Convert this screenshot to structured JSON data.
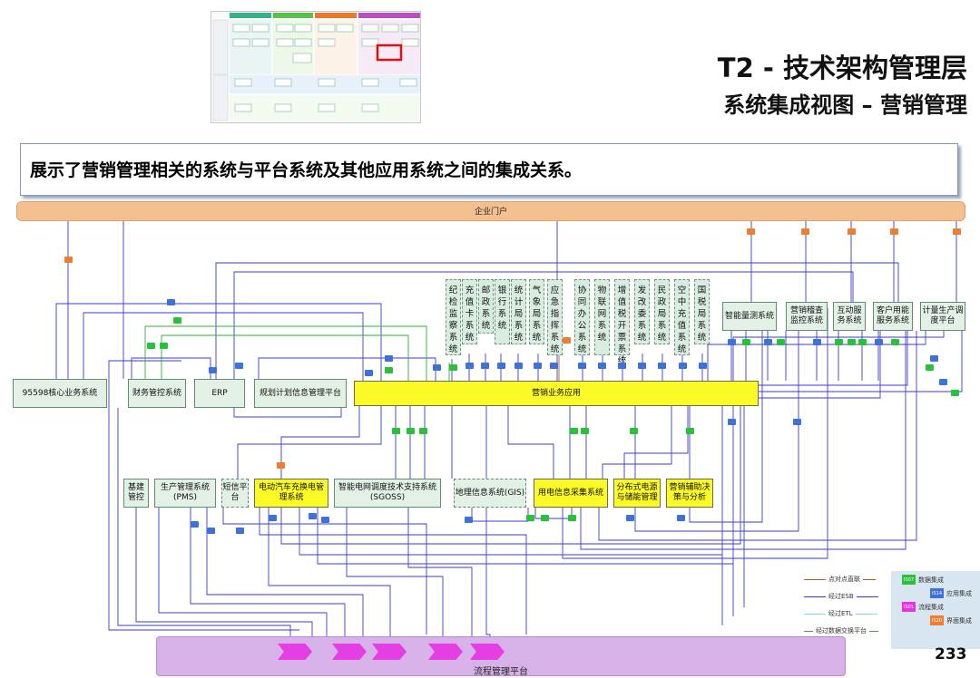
{
  "header": {
    "title": "T2 - 技术架构管理层",
    "subtitle": "系统集成视图 – 营销管理"
  },
  "banner": {
    "text": "展示了营销管理相关的系统与平台系统及其他应用系统之间的集成关系。"
  },
  "portal": {
    "label": "企业门户"
  },
  "flow_platform": {
    "label": "流程管理平台"
  },
  "systems": {
    "s95598": "95598核心业务系统",
    "finance": "财务管控系统",
    "erp": "ERP",
    "planning": "规划计划信息管理平台",
    "marketing_app": "营销业务应用",
    "smart_energy": "智能量测系统",
    "audit": "营销稽查监控系统",
    "interactive": "互动服务系统",
    "customer_energy": "客户用能服务系统",
    "metering": "计量生产调度平台",
    "infra": "基建管控",
    "pms": "生产管理系统(PMS)",
    "sms": "短信平台",
    "ev": "电动汽车充换电管理系统",
    "sgoss": "智能电网调度技术支持系统(SGOSS)",
    "gis": "地理信息系统(GIS)",
    "collect": "用电信息采集系统",
    "distributed": "分布式电源与储能管理",
    "aux": "营销辅助决策与分析"
  },
  "external_systems": [
    {
      "chars": [
        "纪",
        "检",
        "监",
        "察",
        "系",
        "统"
      ]
    },
    {
      "chars": [
        "充",
        "值",
        "卡",
        "系",
        "统"
      ]
    },
    {
      "chars": [
        "邮",
        "政",
        "系",
        "统"
      ]
    },
    {
      "chars": [
        "银",
        "行",
        "系",
        "统"
      ]
    },
    {
      "chars": [
        "统",
        "计",
        "局",
        "系",
        "统"
      ]
    },
    {
      "chars": [
        "气",
        "象",
        "局",
        "系",
        "统"
      ]
    },
    {
      "chars": [
        "应",
        "急",
        "指",
        "挥",
        "系",
        "统"
      ]
    },
    {
      "chars": [
        "协",
        "同",
        "办",
        "公",
        "系",
        "统"
      ]
    },
    {
      "chars": [
        "物",
        "联",
        "网",
        "系",
        "统"
      ]
    },
    {
      "chars": [
        "增",
        "值",
        "税",
        "开",
        "票",
        "系",
        "统"
      ]
    },
    {
      "chars": [
        "发",
        "改",
        "委",
        "系",
        "统"
      ]
    },
    {
      "chars": [
        "民",
        "政",
        "局",
        "系",
        "统"
      ]
    },
    {
      "chars": [
        "空",
        "中",
        "充",
        "值",
        "系",
        "统"
      ]
    },
    {
      "chars": [
        "国",
        "税",
        "局",
        "系",
        "统"
      ]
    }
  ],
  "legend": {
    "lines": [
      {
        "label": "点对点直联",
        "color": "#b05a2a"
      },
      {
        "label": "经过ESB",
        "color": "#3a3ad8"
      },
      {
        "label": "经过ETL",
        "color": "#7fd7e8"
      },
      {
        "label": "经过数据交换平台",
        "color": "#2db12d"
      }
    ],
    "chips": [
      {
        "code": "IS07",
        "label": "数据集成",
        "color": "#29c03a"
      },
      {
        "code": "IS14",
        "label": "应用集成",
        "color": "#3e72d8"
      },
      {
        "code": "IS01",
        "label": "流程集成",
        "color": "#e832e8"
      },
      {
        "code": "IS20",
        "label": "界面集成",
        "color": "#ee7d31"
      }
    ]
  },
  "page_number": "233"
}
